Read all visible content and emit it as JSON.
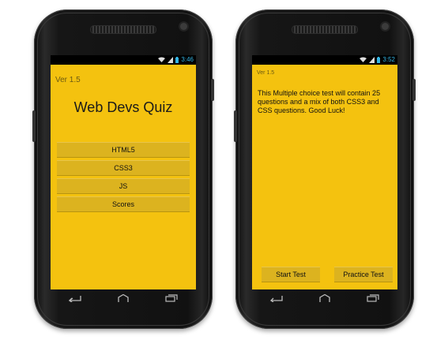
{
  "left_screen": {
    "status_time": "3:46",
    "version": "Ver 1.5",
    "title": "Web Devs Quiz",
    "menu": [
      {
        "label": "HTML5"
      },
      {
        "label": "CSS3"
      },
      {
        "label": "JS"
      },
      {
        "label": "Scores"
      }
    ]
  },
  "right_screen": {
    "status_time": "3:52",
    "version": "Ver 1.5",
    "description": "This Multiple choice test will contain 25 questions and a mix of both CSS3 and CSS questions. Good Luck!",
    "start_label": "Start Test",
    "practice_label": "Practice Test"
  },
  "nav_icons": [
    "back-icon",
    "home-icon",
    "recent-apps-icon"
  ],
  "colors": {
    "screen_bg": "#f4c20f",
    "button_bg": "#dcb31f",
    "status_time": "#33b5e5"
  }
}
